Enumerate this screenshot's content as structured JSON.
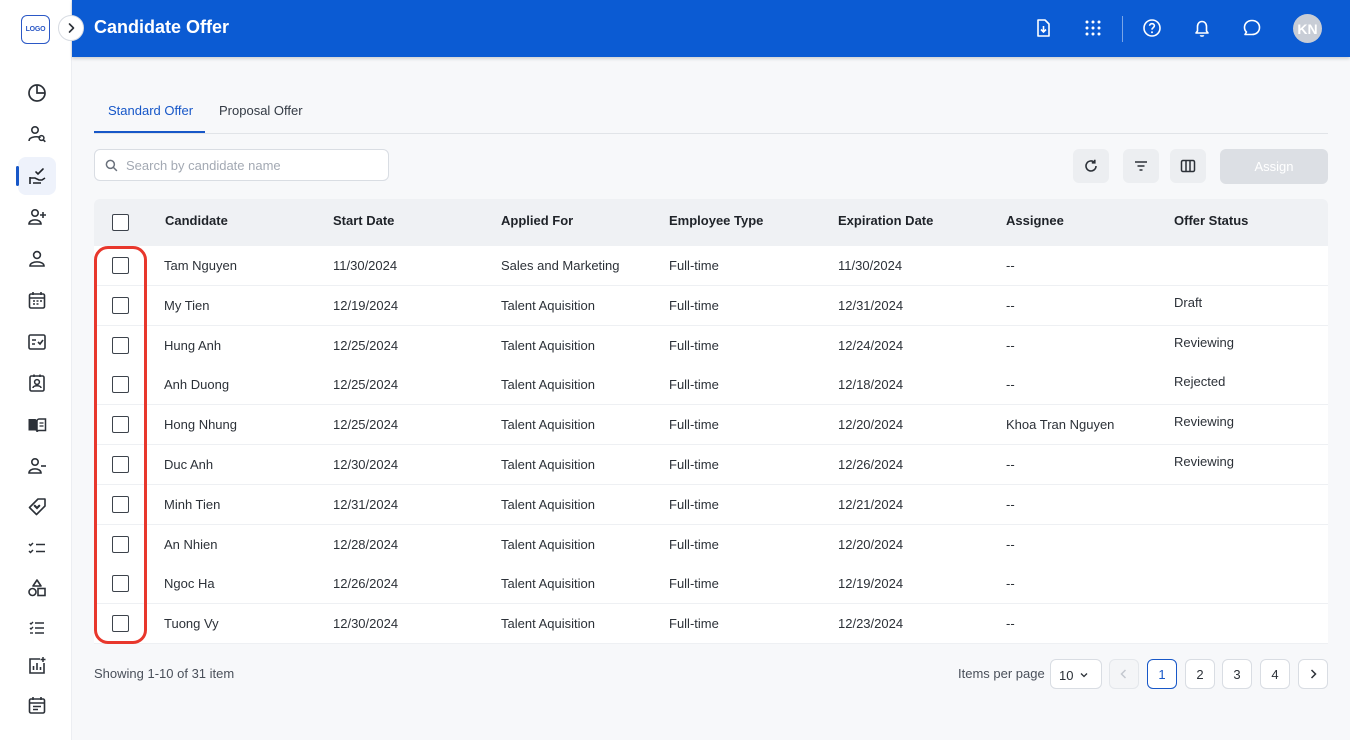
{
  "logo": {
    "text": "LOGO"
  },
  "sidebar": {
    "items": [
      {
        "name": "dashboard-pie-icon",
        "active": false
      },
      {
        "name": "candidate-search-icon",
        "active": false
      },
      {
        "name": "offer-handshake-icon",
        "active": true
      },
      {
        "name": "add-person-icon",
        "active": false
      },
      {
        "name": "person-icon",
        "active": false
      },
      {
        "name": "calendar-icon",
        "active": false
      },
      {
        "name": "checklist-card-icon",
        "active": false
      },
      {
        "name": "contact-card-icon",
        "active": false
      },
      {
        "name": "book-icon",
        "active": false
      },
      {
        "name": "remove-person-icon",
        "active": false
      },
      {
        "name": "tag-heart-icon",
        "active": false
      },
      {
        "name": "task-list-icon",
        "active": false
      },
      {
        "name": "shapes-icon",
        "active": false
      },
      {
        "name": "numbered-list-icon",
        "active": false
      },
      {
        "name": "report-chart-icon",
        "active": false
      },
      {
        "name": "event-calendar-icon",
        "active": false
      }
    ]
  },
  "header": {
    "title": "Candidate Offer",
    "avatar_initials": "KN",
    "accent_color": "#0b5bd3"
  },
  "tabs": [
    {
      "label": "Standard Offer",
      "active": true
    },
    {
      "label": "Proposal Offer",
      "active": false
    }
  ],
  "search": {
    "placeholder": "Search by candidate name",
    "value": ""
  },
  "toolbar": {
    "assign_label": "Assign"
  },
  "table": {
    "headers": [
      "Candidate",
      "Start Date",
      "Applied For",
      "Employee Type",
      "Expiration Date",
      "Assignee",
      "Offer Status"
    ],
    "rows": [
      [
        "Tam Nguyen",
        "11/30/2024",
        "Sales and Marketing",
        "Full-time",
        "11/30/2024",
        "--",
        ""
      ],
      [
        "My Tien",
        "12/19/2024",
        "Talent Aquisition",
        "Full-time",
        "12/31/2024",
        "--",
        "Draft"
      ],
      [
        "Hung Anh",
        "12/25/2024",
        "Talent Aquisition",
        "Full-time",
        "12/24/2024",
        "--",
        "Reviewing"
      ],
      [
        "Anh Duong",
        "12/25/2024",
        "Talent Aquisition",
        "Full-time",
        "12/18/2024",
        "--",
        "Rejected"
      ],
      [
        "Hong Nhung",
        "12/25/2024",
        "Talent Aquisition",
        "Full-time",
        "12/20/2024",
        "Khoa Tran Nguyen",
        "Reviewing"
      ],
      [
        "Duc Anh",
        "12/30/2024",
        "Talent Aquisition",
        "Full-time",
        "12/26/2024",
        "--",
        "Reviewing"
      ],
      [
        "Minh Tien",
        "12/31/2024",
        "Talent Aquisition",
        "Full-time",
        "12/21/2024",
        "--",
        ""
      ],
      [
        "An Nhien",
        "12/28/2024",
        "Talent Aquisition",
        "Full-time",
        "12/20/2024",
        "--",
        ""
      ],
      [
        "Ngoc Ha",
        "12/26/2024",
        "Talent Aquisition",
        "Full-time",
        "12/19/2024",
        "--",
        ""
      ],
      [
        "Tuong Vy",
        "12/30/2024",
        "Talent Aquisition",
        "Full-time",
        "12/23/2024",
        "--",
        ""
      ]
    ]
  },
  "footer": {
    "showing": "Showing 1-10 of 31 item",
    "items_per_page_label": "Items per page",
    "items_per_page_value": "10",
    "pages": [
      "1",
      "2",
      "3",
      "4"
    ],
    "current_page": "1"
  },
  "highlight_color": "#e8372c"
}
